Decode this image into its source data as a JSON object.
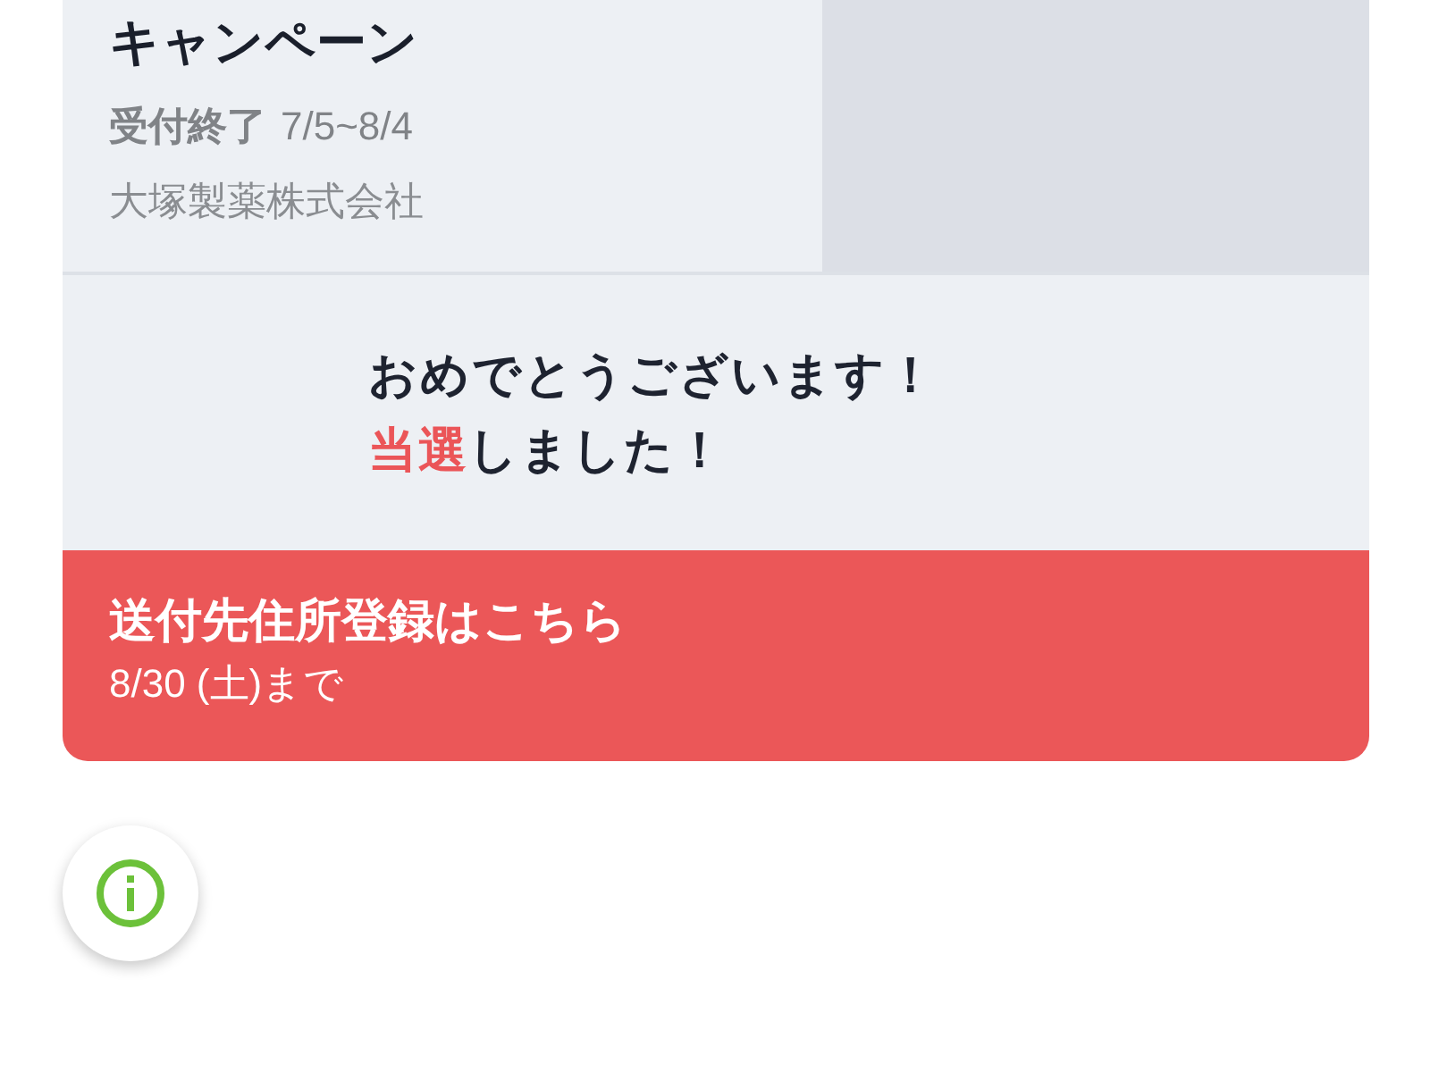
{
  "campaign": {
    "title": "キャンペーン",
    "status": "受付終了",
    "period": "7/5~8/4",
    "company": "大塚製薬株式会社"
  },
  "result": {
    "line_1": "おめでとうございます！",
    "highlight": "当選",
    "line_2_rest": "しました！"
  },
  "action": {
    "title": "送付先住所登録はこちら",
    "deadline": "8/30 (土)まで"
  },
  "info_button": {
    "kind": "info"
  }
}
